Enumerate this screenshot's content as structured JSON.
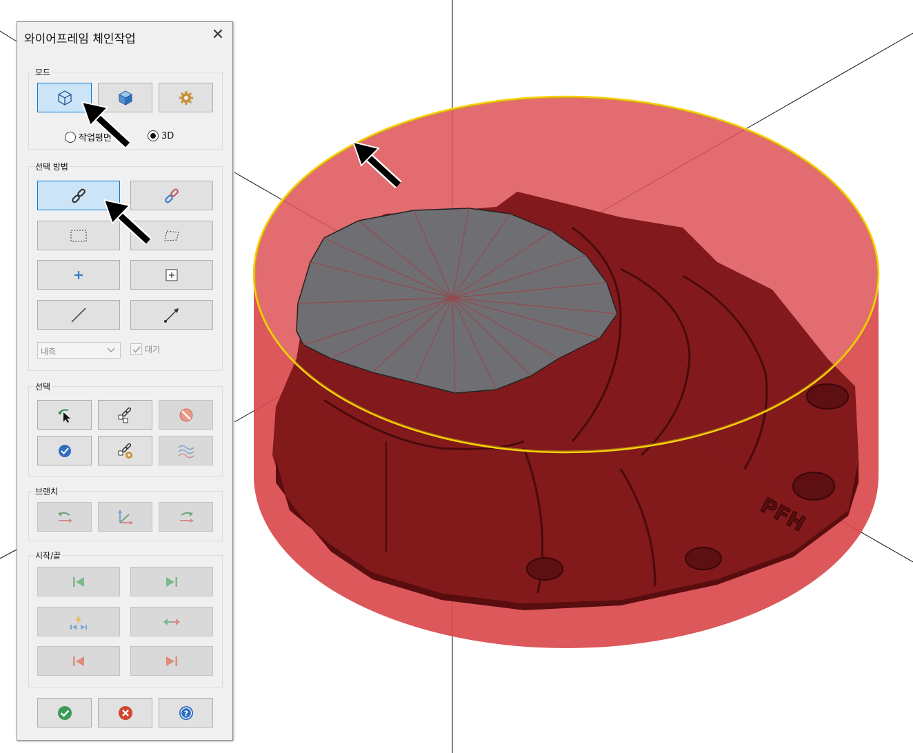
{
  "dialog": {
    "title": "와이어프레임 체인작업",
    "close_glyph": "✕",
    "mode": {
      "label": "모드",
      "buttons": [
        "wireframe-cube-icon",
        "solid-cube-icon",
        "gear-icon"
      ],
      "radio_workplane": "작업평면",
      "radio_3d": "3D",
      "selected_radio": "3D"
    },
    "selection_method": {
      "label": "선택 방법",
      "combo_value": "내측",
      "checkbox_label": "대기",
      "checkbox_checked": true
    },
    "selection": {
      "label": "선택"
    },
    "branch": {
      "label": "브랜치"
    },
    "start_end": {
      "label": "시작/끝"
    }
  },
  "viewport": {
    "fill_color": "#d9363b",
    "part_color": "#7a1416",
    "edge_color": "#f5d20b",
    "part_label": "PFH"
  }
}
